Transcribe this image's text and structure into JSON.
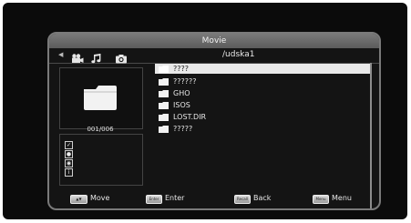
{
  "window": {
    "title": "Movie"
  },
  "tabs": [
    {
      "name": "movie",
      "icon": "film-camera-icon",
      "active": true
    },
    {
      "name": "music",
      "icon": "music-note-icon",
      "active": false
    },
    {
      "name": "photo",
      "icon": "camera-icon",
      "active": false
    }
  ],
  "path": "/udska1",
  "preview": {
    "icon": "folder-icon",
    "counter": "001/006"
  },
  "info_icons": [
    "check-icon",
    "person-icon",
    "disc-icon",
    "info-icon"
  ],
  "files": [
    {
      "name": "????",
      "selected": true
    },
    {
      "name": "??????",
      "selected": false
    },
    {
      "name": "GHO",
      "selected": false
    },
    {
      "name": "ISOS",
      "selected": false
    },
    {
      "name": "LOST.DIR",
      "selected": false
    },
    {
      "name": "?????",
      "selected": false
    }
  ],
  "footer": {
    "move": {
      "key": "▲▼",
      "label": "Move"
    },
    "enter": {
      "key": "Enter",
      "label": "Enter"
    },
    "back": {
      "key": "Recall",
      "label": "Back"
    },
    "menu": {
      "key": "Menu",
      "label": "Menu"
    }
  },
  "colors": {
    "titlebar": "#6b6b6b",
    "selection": "#e9e9e9",
    "background": "#0b0b0b"
  }
}
